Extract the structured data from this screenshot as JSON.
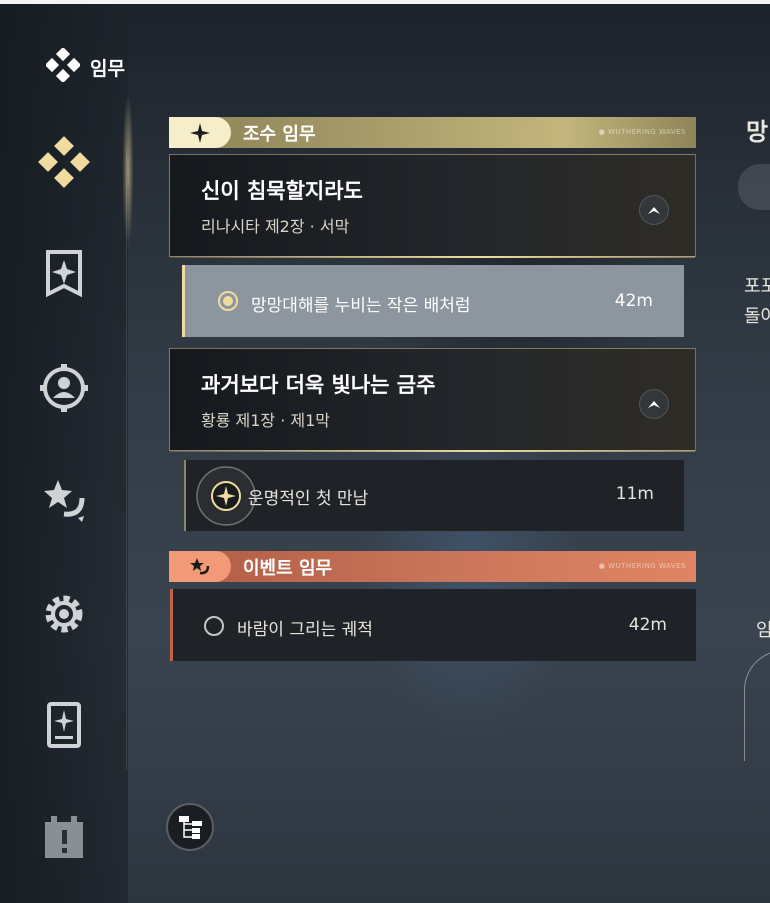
{
  "screen_title": "임무",
  "categories": {
    "main": {
      "label": "조수 임무",
      "tag": "● WUTHERING WAVES",
      "color": "#c9b979"
    },
    "event": {
      "label": "이벤트 임무",
      "tag": "● WUTHERING WAVES",
      "color": "#e08563"
    }
  },
  "chapters": [
    {
      "title": "신이 침묵할지라도",
      "subtitle": "리나시타 제2장 · 서막",
      "quest": {
        "name": "망망대해를 누비는 작은 배처럼",
        "time": "42m",
        "selected": true
      }
    },
    {
      "title": "과거보다 더욱 빛나는 금주",
      "subtitle": "황룡 제1장 · 제1막",
      "quest": {
        "name": "운명적인 첫 만남",
        "time": "11m",
        "selected": false
      }
    }
  ],
  "event_quest": {
    "name": "바람이 그리는 궤적",
    "time": "42m"
  },
  "right_panel": {
    "title_fragment": "망",
    "desc_line1": "포포",
    "desc_line2": "돌아",
    "section_fragment": "임"
  },
  "icons": {
    "nav": [
      "quest-diamond-icon",
      "banner-icon",
      "target-icon",
      "event-star-icon",
      "gear-icon",
      "card-book-icon",
      "calendar-icon"
    ],
    "footer": "quest-tree-icon",
    "chapter_button": "chevron-up-icon"
  },
  "colors": {
    "gold": "#f0dca0",
    "selected_row_bg": "#8d969e",
    "dark_row_bg": "#1f2328"
  }
}
